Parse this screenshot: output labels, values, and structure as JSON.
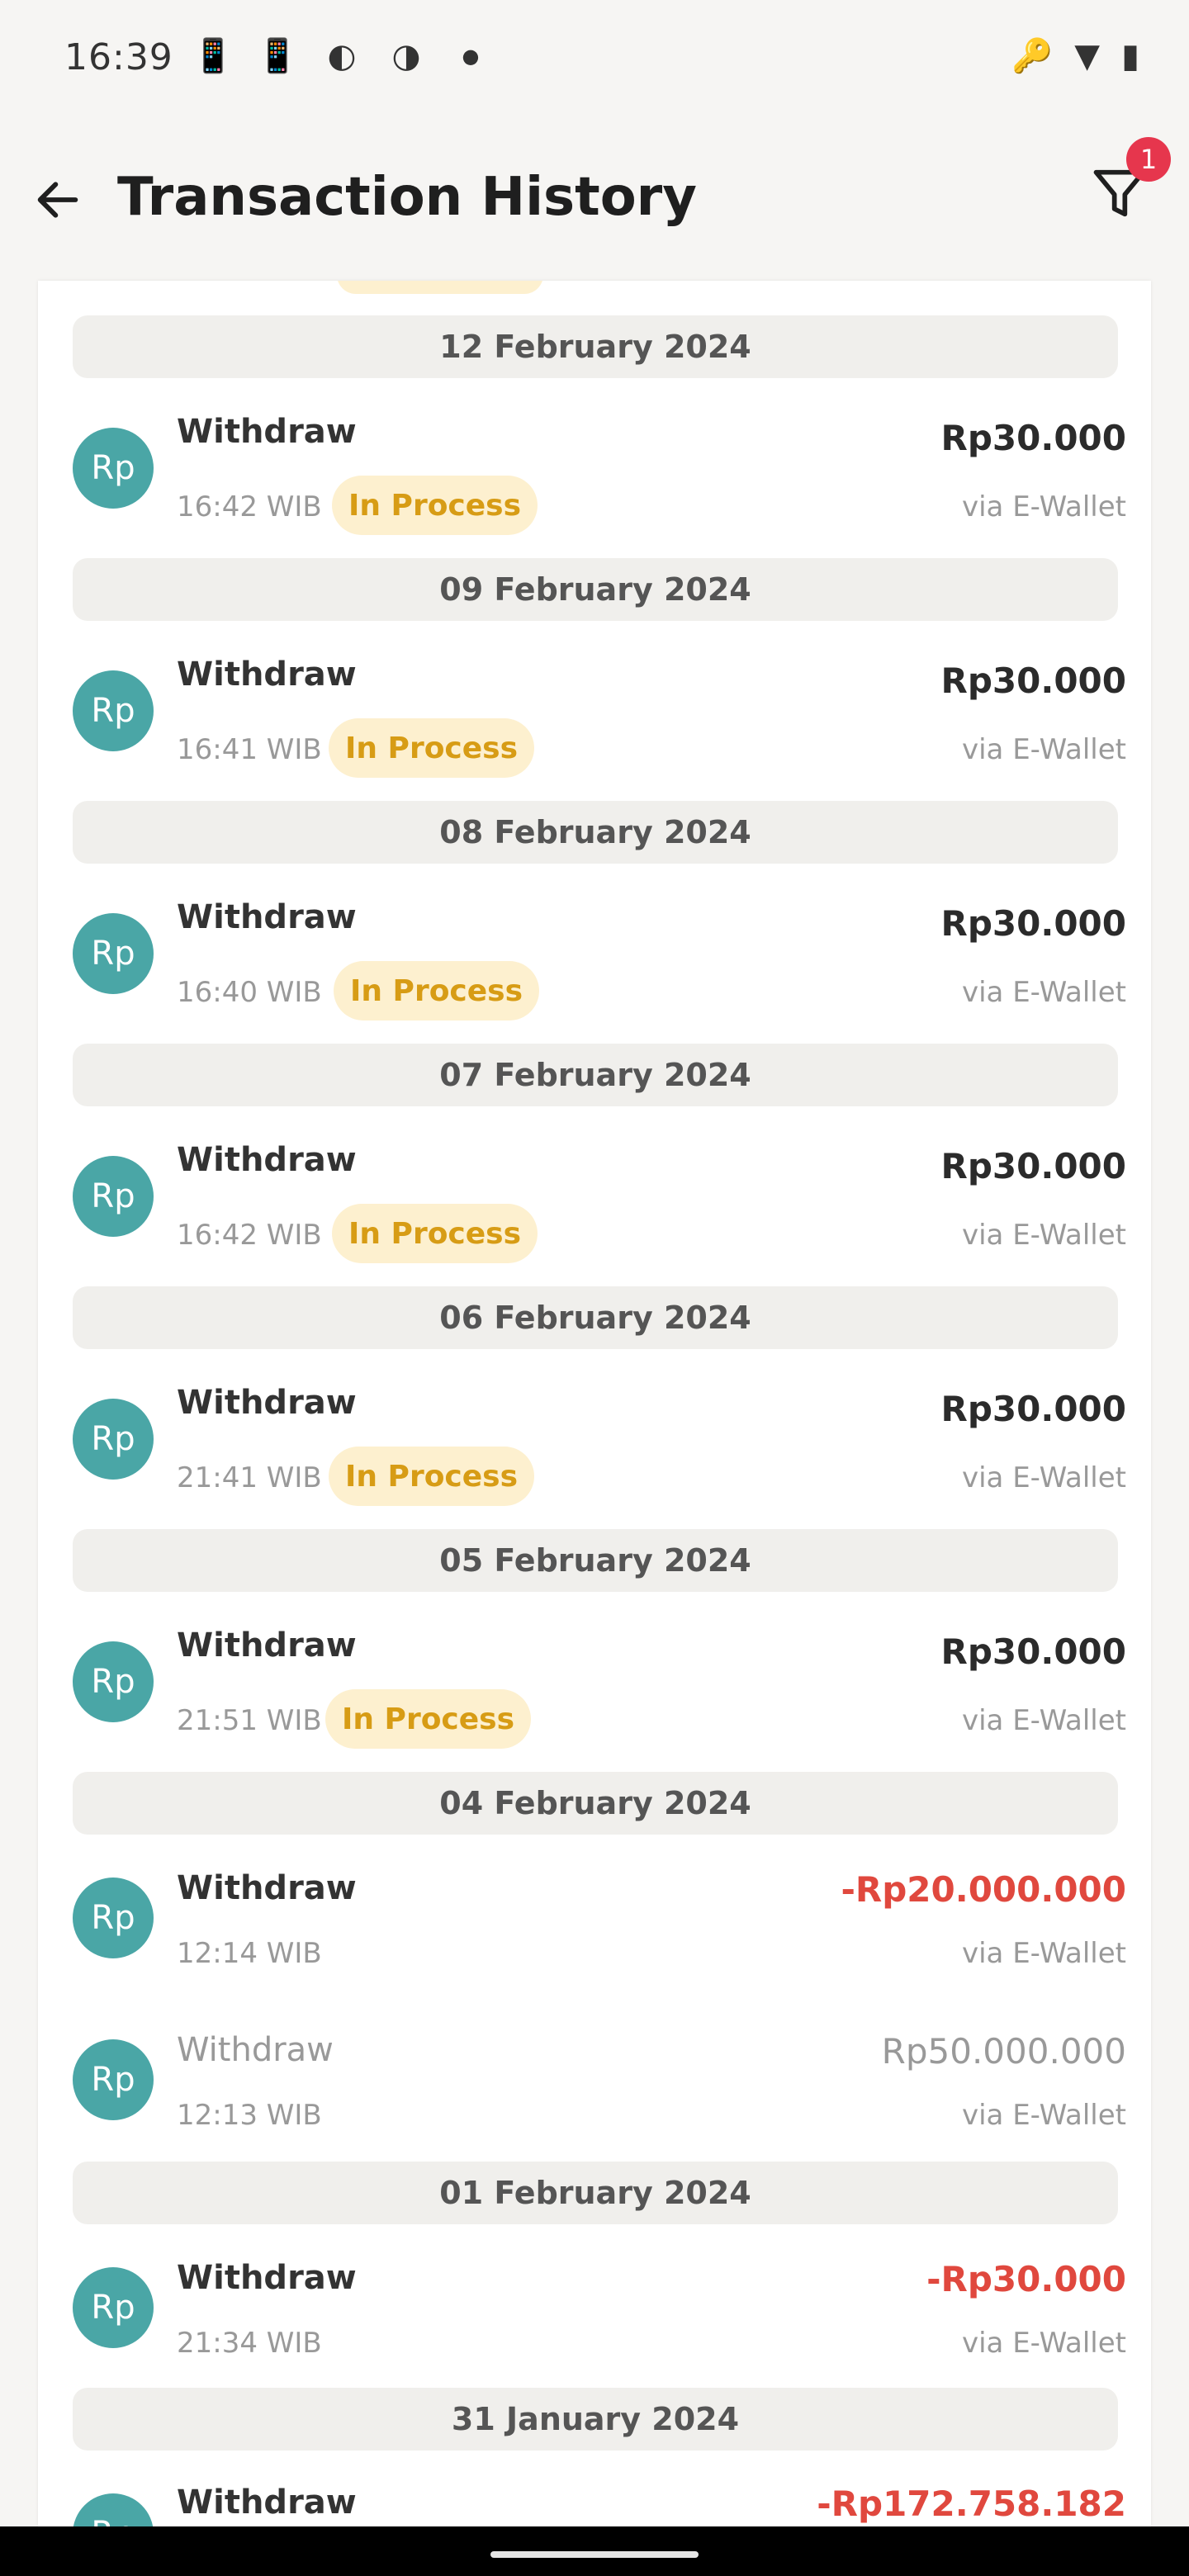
{
  "status_bar": {
    "time": "16:39",
    "left_icons": [
      "sim-icon",
      "sim-icon",
      "app-icon",
      "app-icon",
      "dot-icon"
    ],
    "right_icons": [
      "key-icon",
      "wifi-icon",
      "battery-icon"
    ]
  },
  "header": {
    "title": "Transaction History",
    "filter_badge": "1"
  },
  "colors": {
    "accent_teal": "#4aa6a6",
    "badge_red": "#e6364d",
    "negative_red": "#e0483e",
    "process_bg": "#fdf0cf",
    "process_text": "#d79c15"
  },
  "groups": [
    {
      "date": "12 February 2024",
      "items": [
        {
          "avatar": "Rp",
          "title": "Withdraw",
          "time": "16:42 WIB",
          "status": "In Process",
          "amount": "Rp30.000",
          "method": "via E-Wallet"
        }
      ]
    },
    {
      "date": "09 February 2024",
      "items": [
        {
          "avatar": "Rp",
          "title": "Withdraw",
          "time": "16:41 WIB",
          "status": "In Process",
          "amount": "Rp30.000",
          "method": "via E-Wallet"
        }
      ]
    },
    {
      "date": "08 February 2024",
      "items": [
        {
          "avatar": "Rp",
          "title": "Withdraw",
          "time": "16:40 WIB",
          "status": "In Process",
          "amount": "Rp30.000",
          "method": "via E-Wallet"
        }
      ]
    },
    {
      "date": "07 February 2024",
      "items": [
        {
          "avatar": "Rp",
          "title": "Withdraw",
          "time": "16:42 WIB",
          "status": "In Process",
          "amount": "Rp30.000",
          "method": "via E-Wallet"
        }
      ]
    },
    {
      "date": "06 February 2024",
      "items": [
        {
          "avatar": "Rp",
          "title": "Withdraw",
          "time": "21:41 WIB",
          "status": "In Process",
          "amount": "Rp30.000",
          "method": "via E-Wallet"
        }
      ]
    },
    {
      "date": "05 February 2024",
      "items": [
        {
          "avatar": "Rp",
          "title": "Withdraw",
          "time": "21:51 WIB",
          "status": "In Process",
          "amount": "Rp30.000",
          "method": "via E-Wallet"
        }
      ]
    },
    {
      "date": "04 February 2024",
      "items": [
        {
          "avatar": "Rp",
          "title": "Withdraw",
          "time": "12:14 WIB",
          "amount": "-Rp20.000.000",
          "method": "via E-Wallet"
        },
        {
          "avatar": "Rp",
          "title": "Withdraw",
          "time": "12:13 WIB",
          "amount": "Rp50.000.000",
          "method": "via E-Wallet"
        }
      ]
    },
    {
      "date": "01 February 2024",
      "items": [
        {
          "avatar": "Rp",
          "title": "Withdraw",
          "time": "21:34 WIB",
          "amount": "-Rp30.000",
          "method": "via E-Wallet"
        }
      ]
    },
    {
      "date": "31 January 2024",
      "items": [
        {
          "avatar": "Rp",
          "title": "Withdraw",
          "amount": "-Rp172.758.182"
        }
      ]
    }
  ]
}
